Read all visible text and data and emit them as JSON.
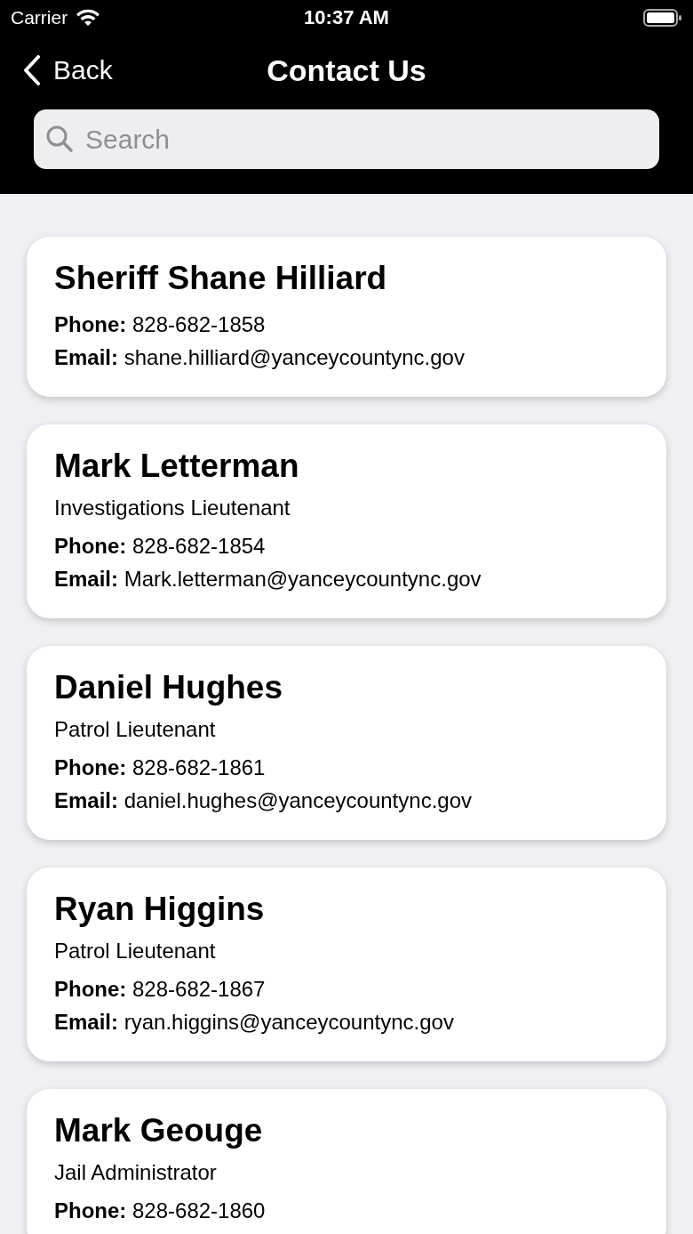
{
  "status_bar": {
    "carrier": "Carrier",
    "time": "10:37 AM"
  },
  "nav": {
    "back": "Back",
    "title": "Contact Us"
  },
  "search": {
    "placeholder": "Search"
  },
  "contacts": [
    {
      "name": "Sheriff Shane Hilliard",
      "phone_label": "Phone:",
      "phone": "828-682-1858",
      "email_label": "Email:",
      "email": "shane.hilliard@yanceycountync.gov"
    },
    {
      "name": "Mark Letterman",
      "title": "Investigations Lieutenant",
      "phone_label": "Phone:",
      "phone": "828-682-1854",
      "email_label": "Email:",
      "email": "Mark.letterman@yanceycountync.gov"
    },
    {
      "name": "Daniel Hughes",
      "title": "Patrol Lieutenant",
      "phone_label": "Phone:",
      "phone": "828-682-1861",
      "email_label": "Email:",
      "email": "daniel.hughes@yanceycountync.gov"
    },
    {
      "name": "Ryan Higgins",
      "title": "Patrol Lieutenant",
      "phone_label": "Phone:",
      "phone": "828-682-1867",
      "email_label": "Email:",
      "email": "ryan.higgins@yanceycountync.gov"
    },
    {
      "name": "Mark Geouge",
      "title": "Jail Administrator",
      "phone_label": "Phone:",
      "phone": "828-682-1860"
    }
  ]
}
